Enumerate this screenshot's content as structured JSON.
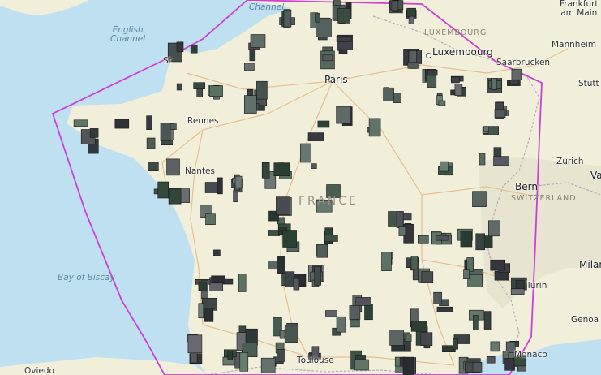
{
  "map": {
    "labels": {
      "english_channel": "English\nChannel",
      "channel": "Channel",
      "bay_of_biscay": "Bay of Biscay",
      "luxembourg_country": "LUXEMBOURG",
      "luxembourg_city": "Luxembourg",
      "france": "FRANCE",
      "switzerland": "SWITZERLAND",
      "paris": "Paris",
      "rennes": "Rennes",
      "nantes": "Nantes",
      "toulouse": "Toulouse",
      "oviedo": "Oviedo",
      "saarbrucken": "Saarbrucken",
      "frankfurt": "Frankfurt\nam Main",
      "mannheim": "Mannheim",
      "stuttgart": "Stutt",
      "zurich": "Zurich",
      "bern": "Bern",
      "milan": "Milan",
      "turin": "Turin",
      "genoa": "Genoa",
      "monaco": "Monaco",
      "st_malo": "St",
      "va": "Va"
    },
    "colors": {
      "sea": "#bfe0f0",
      "land": "#f1efd9",
      "footprint": "#ce3fd4",
      "road": "#e6b98c"
    }
  }
}
